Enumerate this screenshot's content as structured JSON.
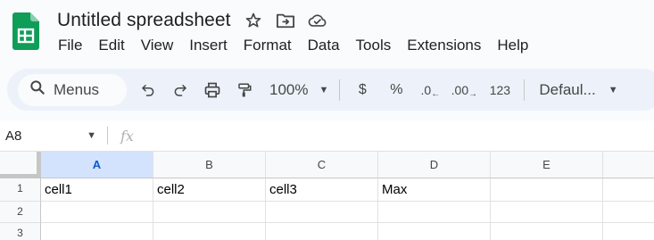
{
  "app": {
    "title": "Untitled spreadsheet",
    "logo_icon": "google-sheets-logo",
    "brand_color": "#0f9d58"
  },
  "title_icons": [
    "star-icon",
    "move-folder-icon",
    "cloud-status-icon"
  ],
  "menu": [
    "File",
    "Edit",
    "View",
    "Insert",
    "Format",
    "Data",
    "Tools",
    "Extensions",
    "Help"
  ],
  "toolbar": {
    "search_label": "Menus",
    "zoom": "100%",
    "currency": "$",
    "percent": "%",
    "decrease_decimal": ".0",
    "increase_decimal": ".00",
    "more_formats": "123",
    "font": "Defaul..."
  },
  "formula_bar": {
    "name_box": "A8",
    "fx_label": "fx"
  },
  "grid": {
    "selected_column": "A",
    "columns": [
      "A",
      "B",
      "C",
      "D",
      "E"
    ],
    "rows": [
      {
        "label": "1",
        "cells": [
          "cell1",
          "cell2",
          "cell3",
          "Max",
          ""
        ]
      },
      {
        "label": "2",
        "cells": [
          "",
          "",
          "",
          "",
          ""
        ]
      },
      {
        "label": "3",
        "cells": [
          "",
          "",
          "",
          "",
          ""
        ]
      }
    ]
  }
}
